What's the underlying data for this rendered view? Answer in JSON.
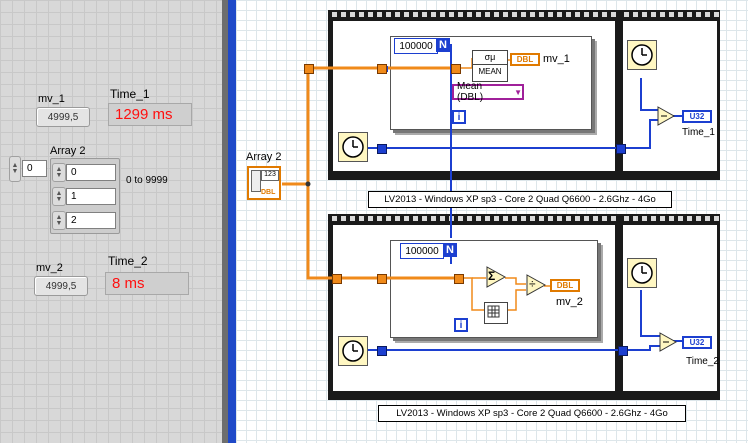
{
  "front_panel": {
    "mv1_label": "mv_1",
    "mv1_value": "4999,5",
    "time1_label": "Time_1",
    "time1_value": "1299 ms",
    "array2_label": "Array 2",
    "array_index": "0",
    "array_values": [
      "0",
      "1",
      "2"
    ],
    "range_note": "0 to 9999",
    "mv2_label": "mv_2",
    "mv2_value": "4999,5",
    "time2_label": "Time_2",
    "time2_value": "8 ms"
  },
  "diagram": {
    "array2_label": "Array 2",
    "array_icon_text": "123",
    "array_type": "DBL",
    "top": {
      "n_const": "100000",
      "n_terminal": "N",
      "i_terminal": "i",
      "mean_vi_label": "MEAN",
      "mean_vi_symbol": "σμ",
      "dropdown_value": "Mean (DBL)",
      "indicator_type": "DBL",
      "indicator_label": "mv_1",
      "time_type": "U32",
      "time_label": "Time_1",
      "caption": "LV2013 - Windows XP sp3 - Core 2 Quad Q6600 - 2.6Ghz - 4Go"
    },
    "bottom": {
      "n_const": "100000",
      "n_terminal": "N",
      "i_terminal": "i",
      "sum_symbol": "Σ",
      "divide_symbol": "÷",
      "indicator_type": "DBL",
      "indicator_label": "mv_2",
      "time_type": "U32",
      "time_label": "Time_2",
      "caption": "LV2013 - Windows XP sp3 - Core 2 Quad Q6600 - 2.6Ghz - 4Go"
    }
  },
  "colors": {
    "dbl_wire": "#f08a1a",
    "u32_wire": "#1c3fd0",
    "time_text": "#ff1010",
    "separator": "#1f49c8"
  }
}
